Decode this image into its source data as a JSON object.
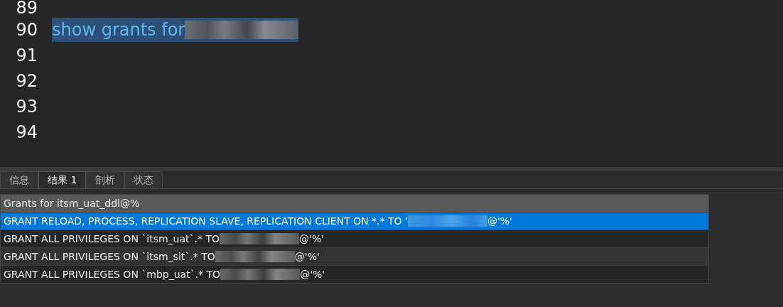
{
  "editor": {
    "lines": [
      {
        "number": "89"
      },
      {
        "number": "90",
        "text": "show grants for ",
        "redacted": true,
        "selected": true
      },
      {
        "number": "91"
      },
      {
        "number": "92"
      },
      {
        "number": "93"
      },
      {
        "number": "94"
      }
    ]
  },
  "tabs": [
    {
      "label": "信息",
      "selected": false
    },
    {
      "label": "结果 1",
      "selected": true
    },
    {
      "label": "剖析",
      "selected": false
    },
    {
      "label": "状态",
      "selected": false
    }
  ],
  "result": {
    "column": "Grants for itsm_uat_ddl@%",
    "rows": [
      {
        "before": "GRANT RELOAD, PROCESS, REPLICATION SLAVE, REPLICATION CLIENT ON *.* TO '",
        "after": "@'%'",
        "selected": true
      },
      {
        "before": "GRANT ALL PRIVILEGES ON `itsm_uat`.* TO",
        "after": "@'%'",
        "selected": false
      },
      {
        "before": "GRANT ALL PRIVILEGES ON `itsm_sit`.* TO",
        "after": "@'%'",
        "selected": false
      },
      {
        "before": "GRANT ALL PRIVILEGES ON `mbp_uat`.* TO",
        "after": "@'%'",
        "selected": false
      }
    ]
  }
}
